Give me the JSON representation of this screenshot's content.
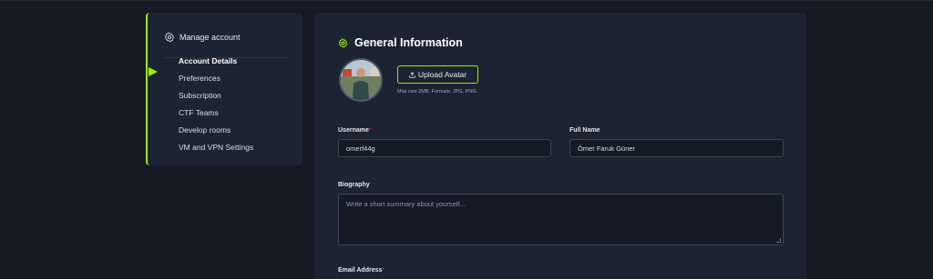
{
  "sidebar": {
    "header": "Manage account",
    "items": [
      {
        "label": "Account Details",
        "active": true
      },
      {
        "label": "Preferences"
      },
      {
        "label": "Subscription"
      },
      {
        "label": "CTF Teams"
      },
      {
        "label": "Develop rooms"
      },
      {
        "label": "VM and VPN Settings"
      }
    ]
  },
  "main": {
    "title": "General Information",
    "upload_label": "Upload Avatar",
    "upload_hint": "Max size 2MB. Formats: JPG, PNG.",
    "username": {
      "label": "Username",
      "required_mark": "*",
      "value": "omerf44g"
    },
    "full_name": {
      "label": "Full Name",
      "value": "Ömer Faruk Güner"
    },
    "biography": {
      "label": "Biography",
      "placeholder": "Write a short summary about yourself..."
    },
    "email": {
      "label": "Email Address",
      "required_mark": "*"
    }
  },
  "colors": {
    "accent": "#9fef00",
    "required": "#ff3e3e",
    "panel": "#1c2433",
    "background": "#141923"
  },
  "icons": {
    "manage_account": "gear-icon",
    "general_info": "gear-icon",
    "upload": "upload-icon"
  }
}
